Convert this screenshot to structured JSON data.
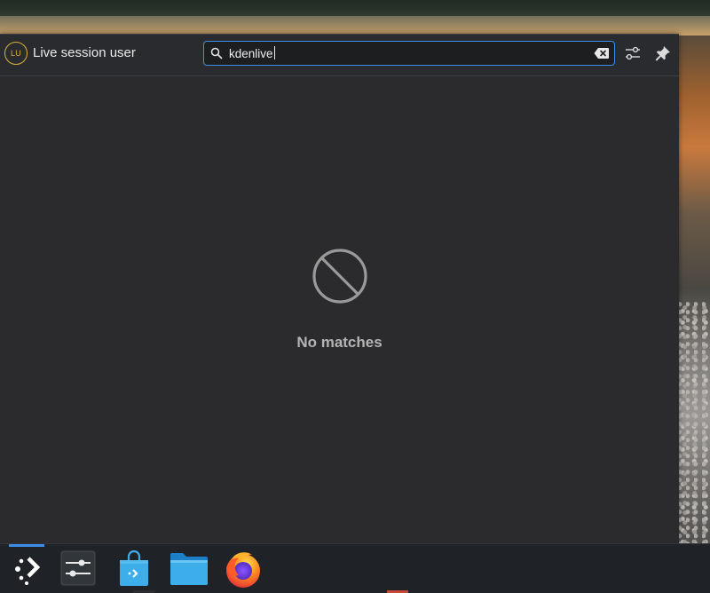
{
  "user": {
    "initials": "LU",
    "name": "Live session user"
  },
  "search": {
    "query": "kdenlive",
    "icon": "search-icon",
    "clear_icon": "backspace-clear-icon"
  },
  "header_buttons": {
    "configure_icon": "sliders-config-icon",
    "pin_icon": "pin-icon"
  },
  "results": {
    "empty_message": "No matches",
    "empty_icon": "no-entry-icon"
  },
  "taskbar": {
    "items": [
      {
        "name": "application-launcher",
        "icon": "kde-launcher-icon",
        "active": true
      },
      {
        "name": "system-settings",
        "icon": "sliders-icon"
      },
      {
        "name": "discover",
        "icon": "store-bag-icon"
      },
      {
        "name": "dolphin",
        "icon": "folder-icon"
      },
      {
        "name": "firefox",
        "icon": "firefox-icon"
      }
    ]
  },
  "colors": {
    "accent": "#3d8ee8",
    "avatar_ring": "#d8b23a",
    "panel_bg": "#2b2b2d"
  }
}
